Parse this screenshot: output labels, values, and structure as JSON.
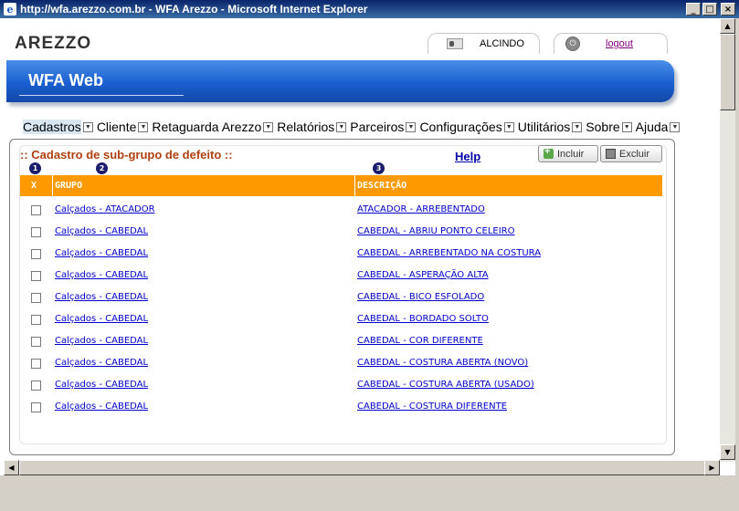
{
  "window": {
    "title": "http://wfa.arezzo.com.br - WFA Arezzo - Microsoft Internet Explorer",
    "minimize": "_",
    "maximize": "□",
    "close": "×"
  },
  "header": {
    "brand": "AREZZO",
    "username": "ALCINDO",
    "logout": "logout",
    "app_title": "WFA Web"
  },
  "menu": [
    {
      "label": "Cadastros",
      "active": true
    },
    {
      "label": "Cliente"
    },
    {
      "label": "Retaguarda Arezzo"
    },
    {
      "label": "Relatórios"
    },
    {
      "label": "Parceiros"
    },
    {
      "label": "Configurações"
    },
    {
      "label": "Utilitários"
    },
    {
      "label": "Sobre"
    },
    {
      "label": "Ajuda"
    }
  ],
  "panel": {
    "title": ":: Cadastro de sub-grupo de defeito ::",
    "help": "Help",
    "incluir": "Incluir",
    "excluir": "Excluir"
  },
  "table": {
    "badges": [
      "1",
      "2",
      "3"
    ],
    "headers": {
      "x": "X",
      "grupo": "GRUPO",
      "descricao": "DESCRIÇÃO"
    },
    "rows": [
      {
        "grupo": "Calçados - ATACADOR",
        "descricao": "ATACADOR - ARREBENTADO"
      },
      {
        "grupo": "Calçados - CABEDAL",
        "descricao": "CABEDAL - ABRIU PONTO CELEIRO"
      },
      {
        "grupo": "Calçados - CABEDAL",
        "descricao": "CABEDAL - ARREBENTADO NA COSTURA"
      },
      {
        "grupo": "Calçados - CABEDAL",
        "descricao": "CABEDAL - ASPERAÇÃO ALTA"
      },
      {
        "grupo": "Calçados - CABEDAL",
        "descricao": "CABEDAL - BICO ESFOLADO"
      },
      {
        "grupo": "Calçados - CABEDAL",
        "descricao": "CABEDAL - BORDADO SOLTO"
      },
      {
        "grupo": "Calçados - CABEDAL",
        "descricao": "CABEDAL - COR DIFERENTE"
      },
      {
        "grupo": "Calçados - CABEDAL",
        "descricao": "CABEDAL - COSTURA ABERTA (NOVO)"
      },
      {
        "grupo": "Calçados - CABEDAL",
        "descricao": "CABEDAL - COSTURA ABERTA (USADO)"
      },
      {
        "grupo": "Calçados - CABEDAL",
        "descricao": "CABEDAL - COSTURA DIFERENTE"
      }
    ]
  }
}
